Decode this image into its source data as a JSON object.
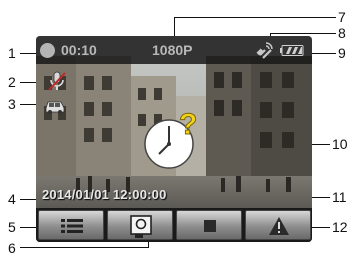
{
  "screen": {
    "status_bar": {
      "recording_time": "00:10",
      "resolution": "1080P",
      "gps_icon": "gps-satellite-icon",
      "battery_icon": "battery-icon"
    },
    "left_indicators": [
      "microphone-icon",
      "car-icon"
    ],
    "datetime_stamp": "2014/01/01 12:00:00",
    "center_icon": "clock-question-icon",
    "toolbar": [
      {
        "icon": "menu-list-icon"
      },
      {
        "icon": "snapshot-icon"
      },
      {
        "icon": "stop-icon"
      },
      {
        "icon": "warning-icon"
      }
    ]
  },
  "callouts": [
    "1",
    "2",
    "3",
    "4",
    "5",
    "6",
    "7",
    "8",
    "9",
    "10",
    "11",
    "12"
  ]
}
